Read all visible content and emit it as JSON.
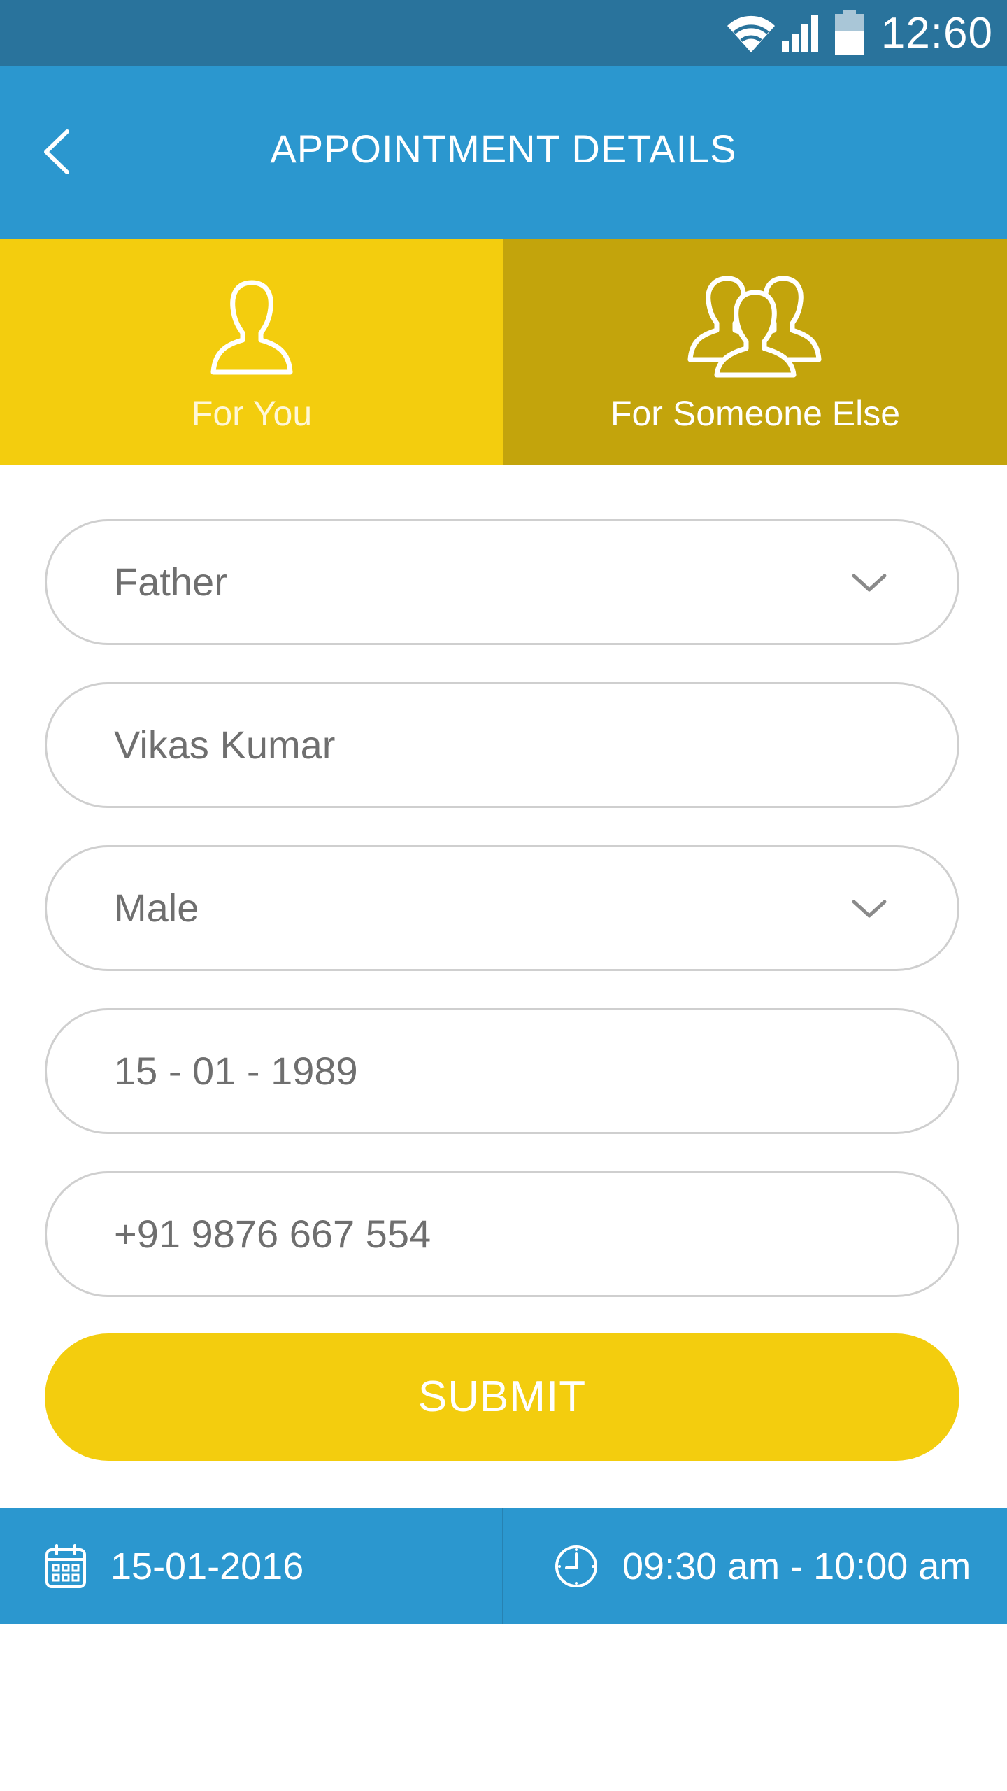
{
  "status_bar": {
    "time": "12:60"
  },
  "header": {
    "title": "APPOINTMENT DETAILS"
  },
  "tabs": [
    {
      "label": "For You",
      "icon": "person-icon",
      "active": false
    },
    {
      "label": "For Someone Else",
      "icon": "group-icon",
      "active": true
    }
  ],
  "form": {
    "relation": {
      "value": "Father"
    },
    "name": {
      "value": "Vikas Kumar"
    },
    "gender": {
      "value": "Male"
    },
    "dob": {
      "value": "15 - 01 - 1989"
    },
    "phone": {
      "value": "+91 9876 667 554"
    }
  },
  "submit": {
    "label": "SUBMIT"
  },
  "footer": {
    "date": "15-01-2016",
    "time_slot": "09:30 am - 10:00 am"
  },
  "colors": {
    "status_bar": "#29739c",
    "primary": "#2b97cf",
    "accent_yellow": "#f3cd0e",
    "active_tab": "#c3a40c",
    "field_border": "#cfcfcf",
    "field_text": "#6f6f6f"
  }
}
